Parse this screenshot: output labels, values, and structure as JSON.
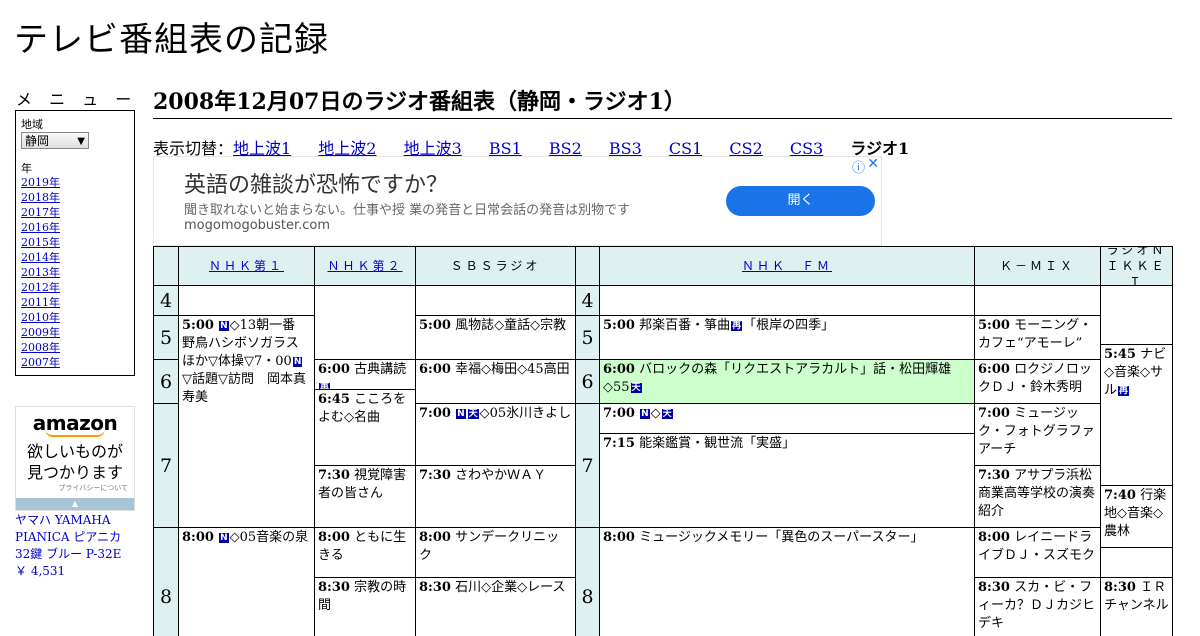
{
  "site": {
    "title": "テレビ番組表の記録"
  },
  "menu": {
    "heading": "メ ニ ュ ー",
    "region_label": "地域",
    "region_selected": "静岡",
    "year_label": "年",
    "years": [
      "2019年",
      "2018年",
      "2017年",
      "2016年",
      "2015年",
      "2014年",
      "2013年",
      "2012年",
      "2011年",
      "2010年",
      "2009年",
      "2008年",
      "2007年"
    ]
  },
  "ad_amazon": {
    "logo": "amazon",
    "tagline_1": "欲しいものが",
    "tagline_2": "見つかります",
    "privacy": "プライバシーについて",
    "product": "ヤマハ YAMAHA PIANICA ピアニカ 32鍵 ブルー P-32E",
    "price": "￥ 4,531"
  },
  "page": {
    "heading": "2008年12月07日のラジオ番組表（静岡・ラジオ1）",
    "switch_label": "表示切替：",
    "switch_links": [
      "地上波1",
      "地上波2",
      "地上波3",
      "BS1",
      "BS2",
      "BS3",
      "CS1",
      "CS2",
      "CS3"
    ],
    "switch_current": "ラジオ1"
  },
  "ad_banner": {
    "headline": "英語の雑談が恐怖ですか？",
    "description": "聞き取れないと始まらない。仕事や授 業の発音と日常会話の発音は別物です",
    "domain": "mogomogobuster.com",
    "button": "開く",
    "info_icon": "ⓘ",
    "close_icon": "✕"
  },
  "schedule": {
    "channels": [
      "ＮＨＫ第１",
      "ＮＨＫ第２",
      "ＳＢＳラジオ",
      "ＮＨＫ　ＦＭ",
      "Ｋ－ＭＩＸ",
      "ラジオＮＩＫＫＥＩ"
    ],
    "hours": [
      "4",
      "5",
      "6",
      "7",
      "8"
    ],
    "programs": {
      "nhk1_0500_time": "5:00",
      "nhk1_0500_text": "◇13朝一番　野鳥ハシボソガラスほか▽体操▽7・00",
      "nhk1_0500_text2": "▽話題▽訪問　岡本真寿美",
      "nhk1_0800_time": "8:00",
      "nhk1_0800_text": "◇05音楽の泉",
      "nhk2_0600_time": "6:00",
      "nhk2_0600_text": "古典講読",
      "nhk2_0645_time": "6:45",
      "nhk2_0645_text": "こころをよむ◇名曲",
      "nhk2_0730_time": "7:30",
      "nhk2_0730_text": "視覚障害者の皆さん",
      "nhk2_0800_time": "8:00",
      "nhk2_0800_text": "ともに生きる",
      "nhk2_0830_time": "8:30",
      "nhk2_0830_text": "宗教の時間",
      "sbs_0500_time": "5:00",
      "sbs_0500_text": "風物誌◇童話◇宗教",
      "sbs_0600_time": "6:00",
      "sbs_0600_text": "幸福◇梅田◇45高田",
      "sbs_0700_time": "7:00",
      "sbs_0700_text": "◇05氷川きよし",
      "sbs_0730_time": "7:30",
      "sbs_0730_text": "さわやかＷＡＹ",
      "sbs_0800_time": "8:00",
      "sbs_0800_text": "サンデークリニック",
      "sbs_0830_time": "8:30",
      "sbs_0830_text": "石川◇企業◇レース",
      "fm_0500_time": "5:00",
      "fm_0500_text": "邦楽百番・箏曲",
      "fm_0500_text2": "「根岸の四季」",
      "fm_0600_time": "6:00",
      "fm_0600_text": "バロックの森「リクエストアラカルト」話・松田輝雄◇55",
      "fm_0700_time": "7:00",
      "fm_0700_text": "◇",
      "fm_0715_time": "7:15",
      "fm_0715_text": "能楽鑑賞・観世流「実盛」",
      "fm_0800_time": "8:00",
      "fm_0800_text": "ミュージックメモリー「異色のスーパースター」",
      "kmix_0500_time": "5:00",
      "kmix_0500_text": "モーニング・カフェ“アモーレ”",
      "kmix_0600_time": "6:00",
      "kmix_0600_text": "ロクジノロックＤＪ・鈴木秀明",
      "kmix_0700_time": "7:00",
      "kmix_0700_text": "ミュージック・フォトグラファアーチ",
      "kmix_0730_time": "7:30",
      "kmix_0730_text": "アサプラ浜松商業高等学校の演奏紹介",
      "kmix_0800_time": "8:00",
      "kmix_0800_text": "レイニードライブＤＪ・スズモク",
      "kmix_0830_time": "8:30",
      "kmix_0830_text": "スカ・ビ・フィーカ？ＤＪカジヒデキ",
      "nikkei_0545_time": "5:45",
      "nikkei_0545_text": "ナビ◇音楽◇サル",
      "nikkei_0740_time": "7:40",
      "nikkei_0740_text": "行楽地◇音楽◇農林",
      "nikkei_0830_time": "8:30",
      "nikkei_0830_text": "ＩＲチャンネル"
    },
    "marks": {
      "news": "N",
      "stereo": "天",
      "repeat": "再"
    }
  },
  "colors": {
    "header_bg": "#dff0f0",
    "highlight_bg": "#ccffcc",
    "link": "#0000cc",
    "ad_button": "#1a73e8"
  }
}
